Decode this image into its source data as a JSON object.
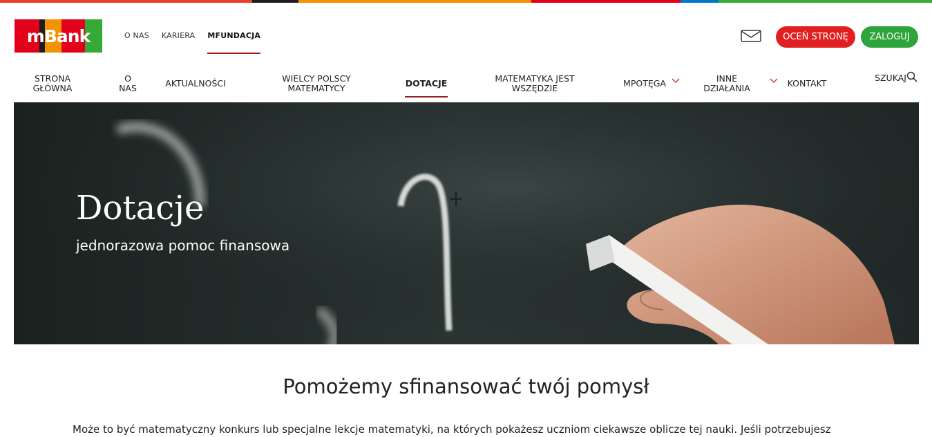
{
  "brand": {
    "logo_text": "mBank",
    "stripe_colors": [
      "#e8402a",
      "#1e1e1e",
      "#f29400",
      "#e2001a",
      "#0077c8",
      "#36a936"
    ],
    "logo_colors": [
      "#e2001a",
      "#1e1e1e",
      "#f29400",
      "#e2001a",
      "#36a936"
    ]
  },
  "top_links": [
    {
      "label": "O NAS"
    },
    {
      "label": "KARIERA"
    },
    {
      "label": "MFUNDACJA",
      "active": true
    }
  ],
  "header_actions": {
    "mail_icon": "envelope-icon",
    "rate_label": "OCEŃ STRONĘ",
    "login_label": "ZALOGUJ",
    "rate_color": "#e02020",
    "login_color": "#2ea53a"
  },
  "main_nav": {
    "items": [
      {
        "label": "STRONA GŁÓWNA"
      },
      {
        "label": "O NAS"
      },
      {
        "label": "AKTUALNOŚCI"
      },
      {
        "label": "WIELCY POLSCY MATEMATYCY"
      },
      {
        "label": "DOTACJE",
        "active": true
      },
      {
        "label": "MATEMATYKA JEST WSZĘDZIE"
      },
      {
        "label": "MPOTĘGA",
        "has_dropdown": true
      },
      {
        "label": "INNE DZIAŁANIA",
        "has_dropdown": true
      },
      {
        "label": "KONTAKT"
      }
    ],
    "search_label": "SZUKAJ",
    "accent": "#9b1c1c"
  },
  "hero": {
    "title": "Dotacje",
    "subtitle": "jednorazowa pomoc finansowa"
  },
  "content": {
    "heading": "Pomożemy sfinansować twój pomysł",
    "paragraph": "Może to być matematyczny konkurs lub specjalne lekcje matematyki, na których pokażesz uczniom ciekawsze oblicze tej nauki. Jeśli potrzebujesz"
  }
}
